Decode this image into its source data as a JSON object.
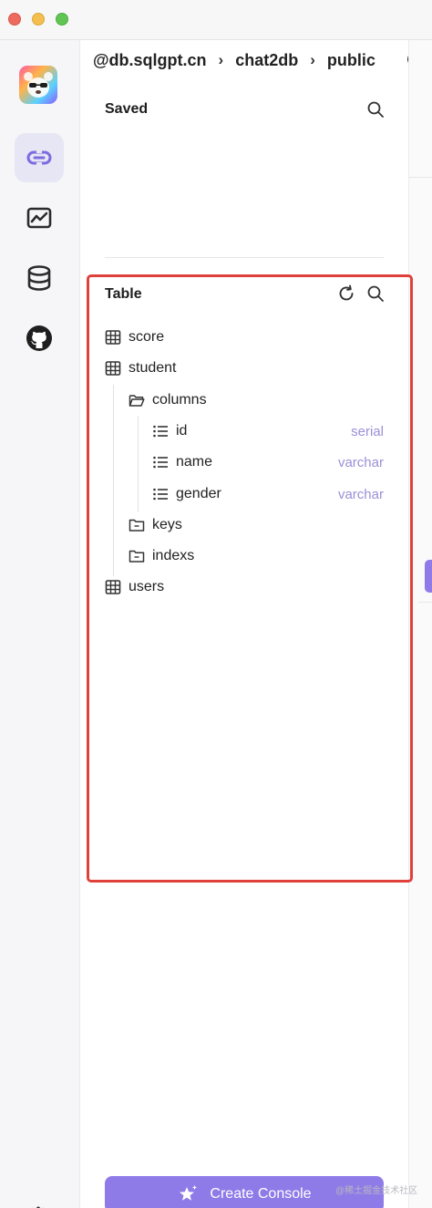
{
  "titlebar": {
    "buttons": [
      "close",
      "minimize",
      "maximize"
    ]
  },
  "activity_bar": {
    "items": [
      {
        "name": "connections",
        "icon": "link-icon",
        "active": true
      },
      {
        "name": "dashboard",
        "icon": "chart-icon",
        "active": false
      },
      {
        "name": "database",
        "icon": "database-icon",
        "active": false
      },
      {
        "name": "github",
        "icon": "github-icon",
        "active": false
      }
    ],
    "settings_icon": "gear-icon"
  },
  "breadcrumb": {
    "items": [
      "@db.sqlgpt.cn",
      "chat2db",
      "public"
    ],
    "separator": "›"
  },
  "saved": {
    "title": "Saved"
  },
  "table_section": {
    "title": "Table",
    "tree": [
      {
        "label": "score"
      },
      {
        "label": "student"
      },
      {
        "label": "columns"
      },
      {
        "label": "id",
        "type": "serial"
      },
      {
        "label": "name",
        "type": "varchar"
      },
      {
        "label": "gender",
        "type": "varchar"
      },
      {
        "label": "keys"
      },
      {
        "label": "indexs"
      },
      {
        "label": "users"
      }
    ]
  },
  "create_console": {
    "label": "Create Console"
  },
  "watermark": "@稀土掘金技术社区",
  "colors": {
    "accent": "#8f7be8",
    "highlight": "#e0403a",
    "type_text": "#9b8fd6"
  }
}
